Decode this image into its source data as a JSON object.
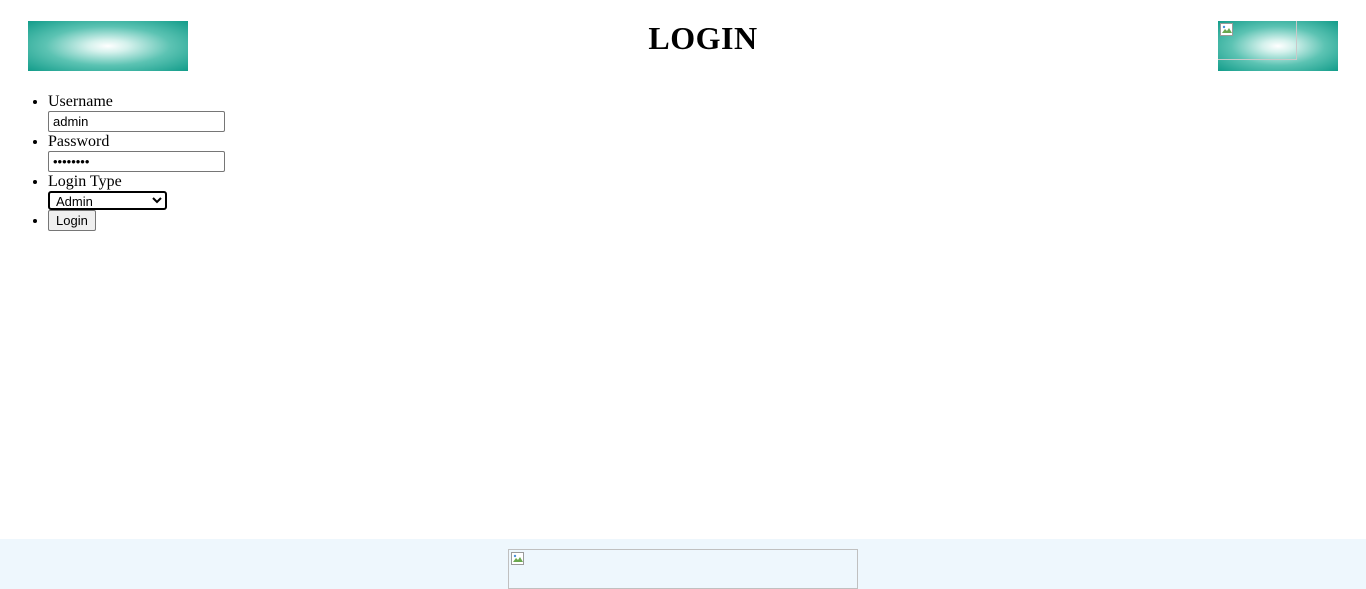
{
  "header": {
    "title": "LOGIN",
    "left_logo": "gradient-banner-logo",
    "right_logo": "broken-image-icon"
  },
  "form": {
    "username": {
      "label": "Username",
      "value": "admin"
    },
    "password": {
      "label": "Password",
      "value": "••••••••"
    },
    "login_type": {
      "label": "Login Type",
      "selected": "Admin"
    },
    "submit_label": "Login"
  },
  "footer": {
    "image": "broken-image-icon"
  },
  "colors": {
    "logo_teal": "#129c8a",
    "footer_bg": "#eef7fd"
  }
}
